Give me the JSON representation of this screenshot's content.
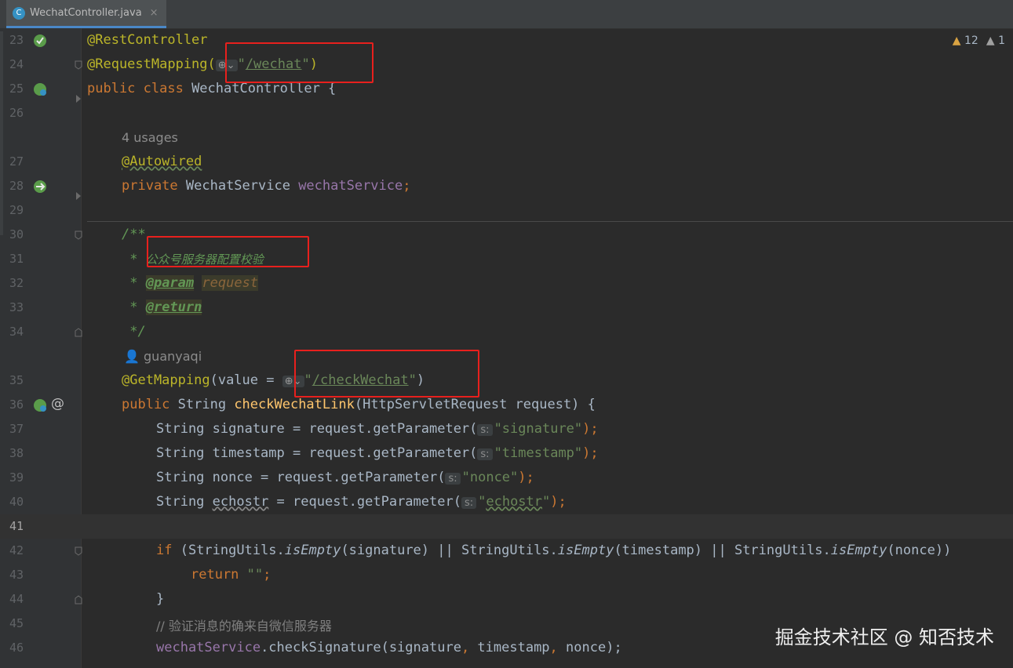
{
  "tab": {
    "icon_letter": "C",
    "filename": "WechatController.java",
    "close": "×"
  },
  "inspections": {
    "warnings": "12",
    "weak_warnings": "1"
  },
  "icons": {
    "tab": "java-class-icon",
    "close": "close-icon",
    "warn": "warning-triangle-icon",
    "globe": "globe-icon",
    "author": "person-icon"
  },
  "lines": {
    "l23": {
      "num": "23",
      "text": "@RestController"
    },
    "l24": {
      "num": "24",
      "pre": "@RequestMapping(",
      "globe": "⊕⌄",
      "q1": "\"",
      "url": "/wechat",
      "q2": "\"",
      "post": ")"
    },
    "l25": {
      "num": "25",
      "kw": "public class ",
      "text": "WechatController {"
    },
    "l26": {
      "num": "26"
    },
    "usages": "4 usages",
    "l27": {
      "num": "27",
      "text": "@Autowired"
    },
    "l28": {
      "num": "28",
      "kw": "private ",
      "type": "WechatService ",
      "fld": "wechatService",
      "semi": ";"
    },
    "l29": {
      "num": "29"
    },
    "l30": {
      "num": "30",
      "text": "/**"
    },
    "l31": {
      "num": "31",
      "star": " * ",
      "text": "公众号服务器配置校验"
    },
    "l32": {
      "num": "32",
      "star": " * ",
      "tag": "@param",
      "param": "request"
    },
    "l33": {
      "num": "33",
      "star": " * ",
      "tag": "@return"
    },
    "l34": {
      "num": "34",
      "text": " */"
    },
    "author": "guanyaqi",
    "l35": {
      "num": "35",
      "ann": "@GetMapping",
      "pre": "(value = ",
      "globe": "⊕⌄",
      "q1": "\"",
      "url": "/checkWechat",
      "q2": "\"",
      "post": ")"
    },
    "l36": {
      "num": "36",
      "kw": "public ",
      "type": "String ",
      "mth": "checkWechatLink",
      "post": "(HttpServletRequest request) {"
    },
    "l37": {
      "num": "37",
      "pre": "String signature = request.getParameter(",
      "hint": "s:",
      "str": "\"signature\"",
      "post": ");"
    },
    "l38": {
      "num": "38",
      "pre": "String timestamp = request.getParameter(",
      "hint": "s:",
      "str": "\"timestamp\"",
      "post": ");"
    },
    "l39": {
      "num": "39",
      "pre": "String nonce = request.getParameter(",
      "hint": "s:",
      "str": "\"nonce\"",
      "post": ");"
    },
    "l40": {
      "num": "40",
      "pre1": "String ",
      "var": "echostr",
      "pre2": " = request.getParameter(",
      "hint": "s:",
      "q1": "\"",
      "str": "echostr",
      "q2": "\"",
      "post": ");"
    },
    "l41": {
      "num": "41"
    },
    "l42": {
      "num": "42",
      "kw": "if ",
      "a": "(StringUtils.",
      "m1": "isEmpty",
      "b": "(signature) || StringUtils.",
      "m2": "isEmpty",
      "c": "(timestamp) || StringUtils.",
      "m3": "isEmpty",
      "d": "(nonce))"
    },
    "l43": {
      "num": "43",
      "kw": "return ",
      "str": "\"\"",
      "post": ";"
    },
    "l44": {
      "num": "44",
      "text": "}"
    },
    "l45": {
      "num": "45",
      "text": "// 验证消息的确来自微信服务器"
    },
    "l46": {
      "num": "46",
      "fld": "wechatService",
      "post": ".checkSignature(signature",
      "c1": ",",
      "p2": " timestamp",
      "c2": ",",
      "p3": " nonce);"
    }
  },
  "watermark": "掘金技术社区 @ 知否技术"
}
